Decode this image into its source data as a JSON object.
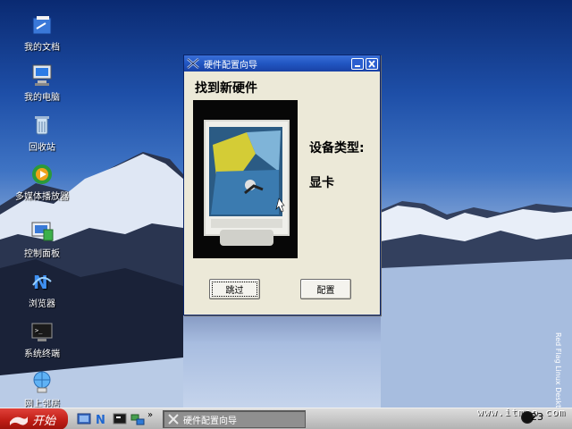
{
  "desktop": {
    "icons": [
      {
        "label": "我的文档",
        "icon": "documents-folder-icon"
      },
      {
        "label": "我的电脑",
        "icon": "computer-icon"
      },
      {
        "label": "回收站",
        "icon": "recycle-bin-icon"
      },
      {
        "label": "多媒体播放器",
        "icon": "media-player-icon"
      },
      {
        "label": "控制面板",
        "icon": "control-panel-icon"
      },
      {
        "label": "浏览器",
        "icon": "browser-icon"
      },
      {
        "label": "系统终端",
        "icon": "terminal-icon"
      },
      {
        "label": "网上邻居",
        "icon": "network-icon"
      }
    ],
    "side_text": "Red Flag Linux Desktop"
  },
  "dialog": {
    "title": "硬件配置向导",
    "heading": "找到新硬件",
    "device_type_label": "设备类型:",
    "device_type_value": "显卡",
    "skip_button": "跳过",
    "configure_button": "配置"
  },
  "taskbar": {
    "start_label": "开始",
    "quick_launch_more": "»",
    "task_item_label": "硬件配置向导",
    "clock": "23",
    "watermark": "www.itmop.com"
  }
}
